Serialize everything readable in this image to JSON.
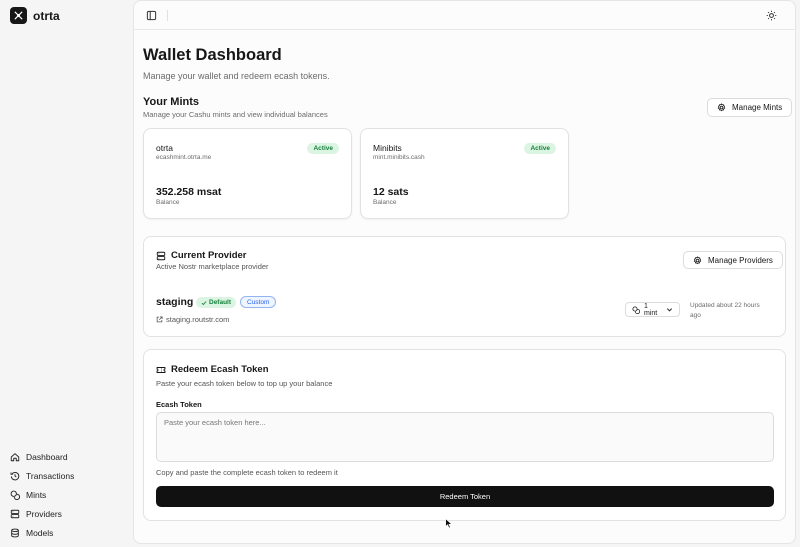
{
  "app": {
    "brand_name": "otrta"
  },
  "sidebar": {
    "items": [
      {
        "label": "Dashboard",
        "icon": "home-icon"
      },
      {
        "label": "Transactions",
        "icon": "history-icon"
      },
      {
        "label": "Mints",
        "icon": "coins-icon"
      },
      {
        "label": "Providers",
        "icon": "server-icon"
      },
      {
        "label": "Models",
        "icon": "database-icon"
      }
    ]
  },
  "topbar": {
    "sidebar_toggle_icon": "panel-left-icon",
    "theme_icon": "sun-icon"
  },
  "page": {
    "title": "Wallet Dashboard",
    "subtitle": "Manage your wallet and redeem ecash tokens."
  },
  "mints_section": {
    "title": "Your Mints",
    "subtitle": "Manage your Cashu mints and view individual balances",
    "manage_button": "Manage Mints",
    "mints": [
      {
        "name": "otrta",
        "url": "ecashmint.otrta.me",
        "status": "Active",
        "balance": "352.258 msat",
        "balance_label": "Balance"
      },
      {
        "name": "Minibits",
        "url": "mint.minibits.cash",
        "status": "Active",
        "balance": "12 sats",
        "balance_label": "Balance"
      }
    ]
  },
  "provider": {
    "title": "Current Provider",
    "subtitle": "Active Nostr marketplace provider",
    "manage_button": "Manage Providers",
    "name": "staging",
    "badge_default": "Default",
    "badge_custom": "Custom",
    "url": "staging.routstr.com",
    "mint_select": "1 mint",
    "updated": "Updated about 22 hours ago"
  },
  "redeem": {
    "title": "Redeem Ecash Token",
    "subtitle": "Paste your ecash token below to top up your balance",
    "field_label": "Ecash Token",
    "placeholder": "Paste your ecash token here...",
    "value": "",
    "helper": "Copy and paste the complete ecash token to redeem it",
    "button": "Redeem Token"
  },
  "colors": {
    "accent_dark": "#111111",
    "active_badge_bg": "#dcf5e3",
    "active_badge_text": "#15803d",
    "custom_badge_text": "#2563eb"
  }
}
